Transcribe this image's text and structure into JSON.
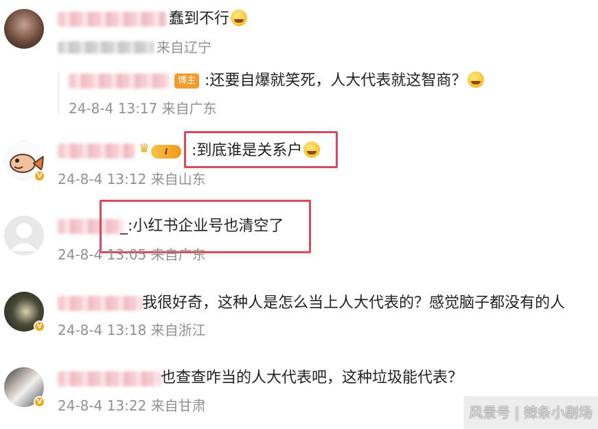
{
  "comments": [
    {
      "text": "蠢到不行",
      "meta": "来自辽宁"
    },
    {
      "host_badge": "博主",
      "text": ":还要自爆就笑死，人大代表就这智商？",
      "meta": "24-8-4 13:17 来自广东"
    },
    {
      "level_badge": "I",
      "text": ":到底谁是关系户",
      "meta": "24-8-4 13:12 来自山东"
    },
    {
      "text": "_:小红书企业号也清空了",
      "meta": "24-8-4 13:05 来自广东"
    },
    {
      "text": "我很好奇，这种人是怎么当上人大代表的？感觉脑子都没有的人",
      "meta": "24-8-4 13:18 来自浙江"
    },
    {
      "text": "也查查咋当的人大代表吧，这种垃圾能代表？",
      "meta": "24-8-4 13:22 来自甘肃"
    }
  ],
  "watermark": "风景号 | 辣条小剧场",
  "colors": {
    "highlight": "#d84a5a",
    "meta_text": "#909090",
    "host_badge": "#f59a2c",
    "verified_badge": "#f2a81c"
  }
}
